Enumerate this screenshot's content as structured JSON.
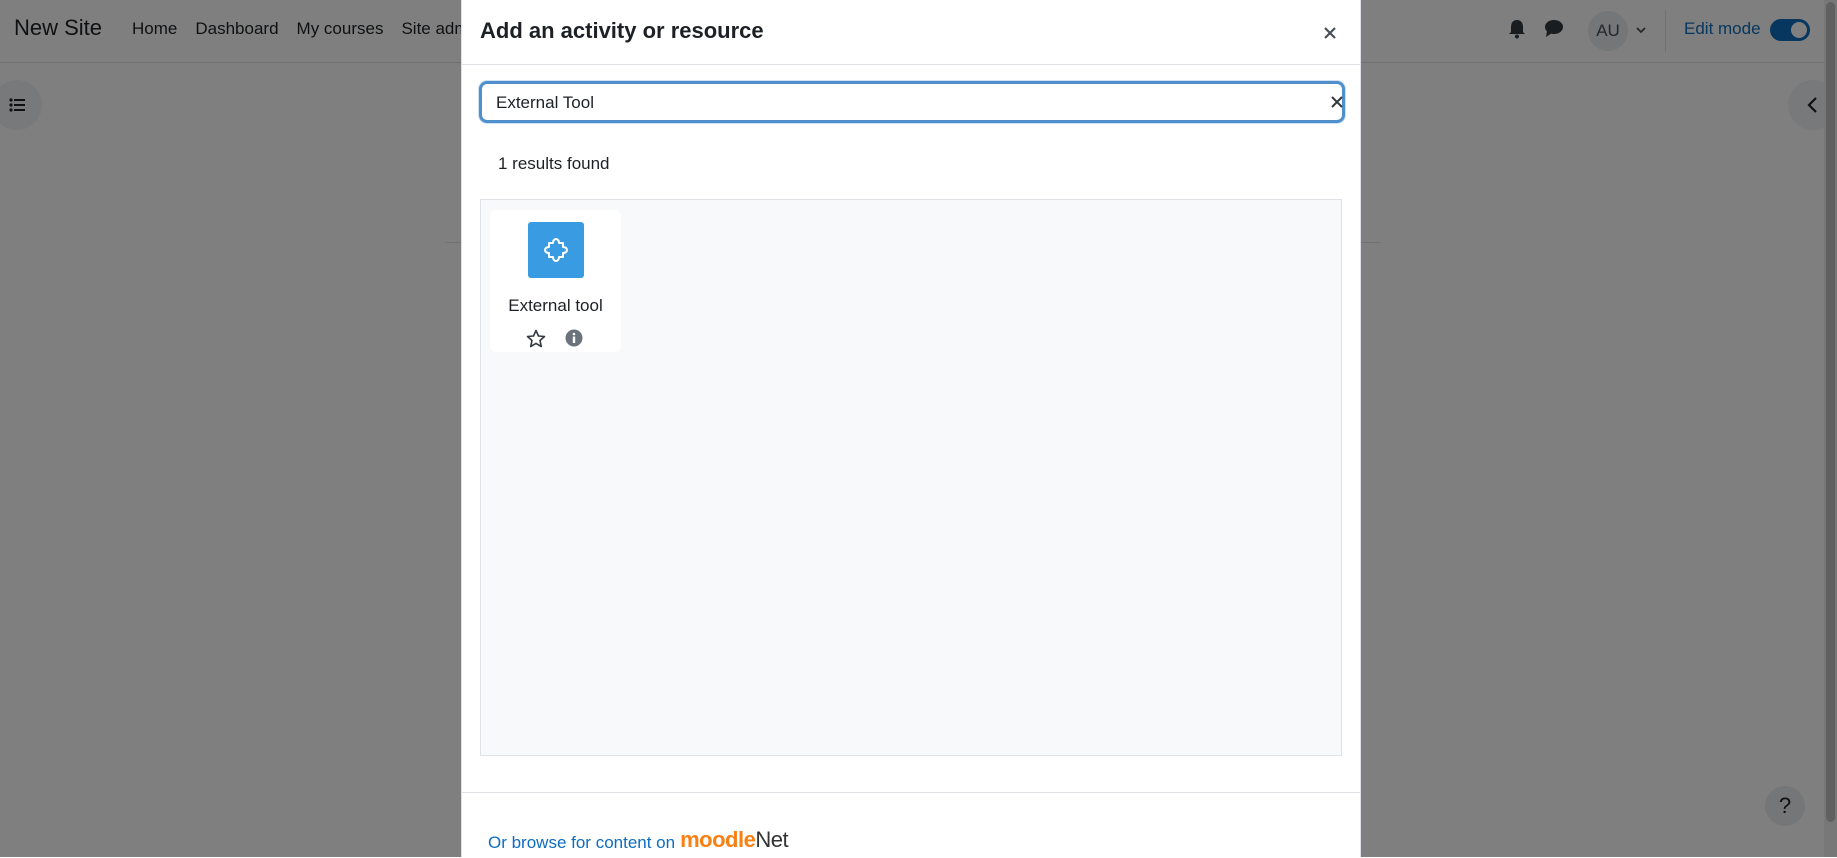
{
  "navbar": {
    "brand": "New Site",
    "links": [
      "Home",
      "Dashboard",
      "My courses",
      "Site adm"
    ],
    "avatar_initials": "AU",
    "edit_mode_label": "Edit mode",
    "edit_mode_on": true
  },
  "modal": {
    "title": "Add an activity or resource",
    "search_value": "External Tool",
    "results_count": "1 results found",
    "results": [
      {
        "label": "External tool",
        "icon": "puzzle-icon"
      }
    ],
    "footer_text": "Or browse for content on",
    "footer_brand": "moodle",
    "footer_brand_suffix": "Net"
  },
  "help_label": "?",
  "colors": {
    "accent": "#0f6cbf",
    "tile_icon_bg": "#399be2",
    "moodle_orange": "#f98012"
  }
}
